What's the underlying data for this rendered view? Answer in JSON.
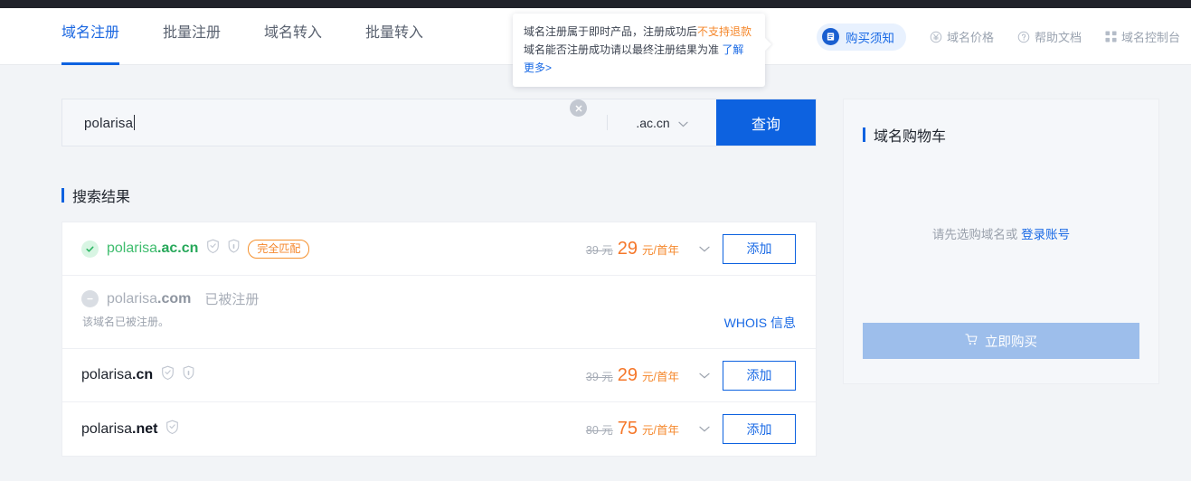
{
  "topnav": {
    "tabs": [
      {
        "label": "域名注册",
        "active": true
      },
      {
        "label": "批量注册",
        "active": false
      },
      {
        "label": "域名转入",
        "active": false
      },
      {
        "label": "批量转入",
        "active": false
      }
    ],
    "notice_button": "购买须知",
    "links": [
      {
        "label": "域名价格",
        "icon": "yen-circle-icon"
      },
      {
        "label": "帮助文档",
        "icon": "question-circle-icon"
      },
      {
        "label": "域名控制台",
        "icon": "grid-icon"
      }
    ]
  },
  "tooltip": {
    "line1_prefix": "域名注册属于即时产品，注册成功后",
    "line1_warn": "不支持退款",
    "line2_prefix": "域名能否注册成功请以最终注册结果为准 ",
    "line2_link": "了解更多>"
  },
  "search": {
    "value": "polarisa",
    "clear_icon": "clear-circle-icon",
    "tld": ".ac.cn",
    "button": "查询"
  },
  "results_section": {
    "title": "搜索结果",
    "rows": [
      {
        "domain_sld": "polarisa",
        "domain_tld": ".ac.cn",
        "state": "available",
        "status_icon": "check-circle-icon",
        "shields": [
          "shield-check-icon",
          "shield-lock-icon"
        ],
        "badge": "完全匹配",
        "price_old": "39 元",
        "price_new": "29",
        "price_unit": "元/首年",
        "action": "添加"
      },
      {
        "domain_sld": "polarisa",
        "domain_tld": ".com",
        "state": "taken",
        "status_icon": "minus-circle-icon",
        "taken_label": "已被注册",
        "sub_note": "该域名已被注册。",
        "whois_link": "WHOIS 信息"
      },
      {
        "domain_sld": "polarisa",
        "domain_tld": ".cn",
        "state": "available",
        "shields": [
          "shield-check-icon",
          "shield-lock-icon"
        ],
        "price_old": "39 元",
        "price_new": "29",
        "price_unit": "元/首年",
        "action": "添加"
      },
      {
        "domain_sld": "polarisa",
        "domain_tld": ".net",
        "state": "available",
        "shields": [
          "shield-check-icon"
        ],
        "price_old": "80 元",
        "price_new": "75",
        "price_unit": "元/首年",
        "action": "添加"
      }
    ]
  },
  "cart": {
    "title": "域名购物车",
    "empty_text": "请先选购域名或 ",
    "empty_link": "登录账号",
    "buy_button": "立即购买",
    "buy_icon": "cart-icon"
  },
  "colors": {
    "brand_blue": "#0d62e0",
    "link_blue": "#1a6ae5",
    "accent_orange": "#f5872b",
    "available_green": "#3fbd6e",
    "muted_gray": "#a8aeb8"
  }
}
